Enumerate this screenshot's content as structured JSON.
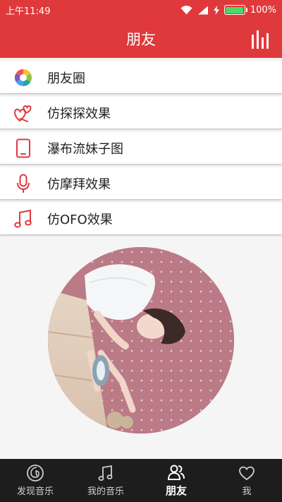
{
  "status_bar": {
    "time": "上午11:49",
    "battery_percent": "100%",
    "battery_color": "#4cd964",
    "icons": [
      "wifi-icon",
      "signal-icon",
      "charging-icon",
      "battery-icon"
    ]
  },
  "header": {
    "title": "朋友",
    "action_icon": "playlist-bars-icon",
    "background": "#e0393c"
  },
  "menu": {
    "items": [
      {
        "label": "朋友圈",
        "icon": "camera-aperture-icon"
      },
      {
        "label": "仿探探效果",
        "icon": "hearts-icon"
      },
      {
        "label": "瀑布流妹子图",
        "icon": "tablet-icon"
      },
      {
        "label": "仿摩拜效果",
        "icon": "microphone-icon"
      },
      {
        "label": "仿OFO效果",
        "icon": "music-notes-icon"
      }
    ],
    "icon_color": "#e0393c"
  },
  "photo": {
    "description_icon": "photo-girl-image"
  },
  "bottom_nav": {
    "items": [
      {
        "label": "发现音乐",
        "icon": "netease-music-icon",
        "active": false
      },
      {
        "label": "我的音乐",
        "icon": "music-note-icon",
        "active": false
      },
      {
        "label": "朋友",
        "icon": "friends-icon",
        "active": true
      },
      {
        "label": "我",
        "icon": "heart-icon",
        "active": false
      }
    ]
  }
}
